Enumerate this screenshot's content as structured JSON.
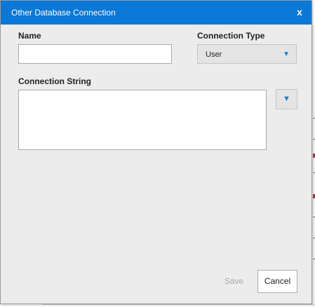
{
  "dialog": {
    "title": "Other Database Connection",
    "close_glyph": "x"
  },
  "form": {
    "name_label": "Name",
    "name_value": "",
    "connection_type_label": "Connection Type",
    "connection_type_value": "User",
    "connection_string_label": "Connection String",
    "connection_string_value": "",
    "dropdown_arrow": "▼"
  },
  "actions": {
    "save_label": "Save",
    "cancel_label": "Cancel"
  },
  "colors": {
    "titlebar": "#0a78d7",
    "accent_arrow": "#1a7fd4",
    "dialog_bg": "#ececec"
  }
}
